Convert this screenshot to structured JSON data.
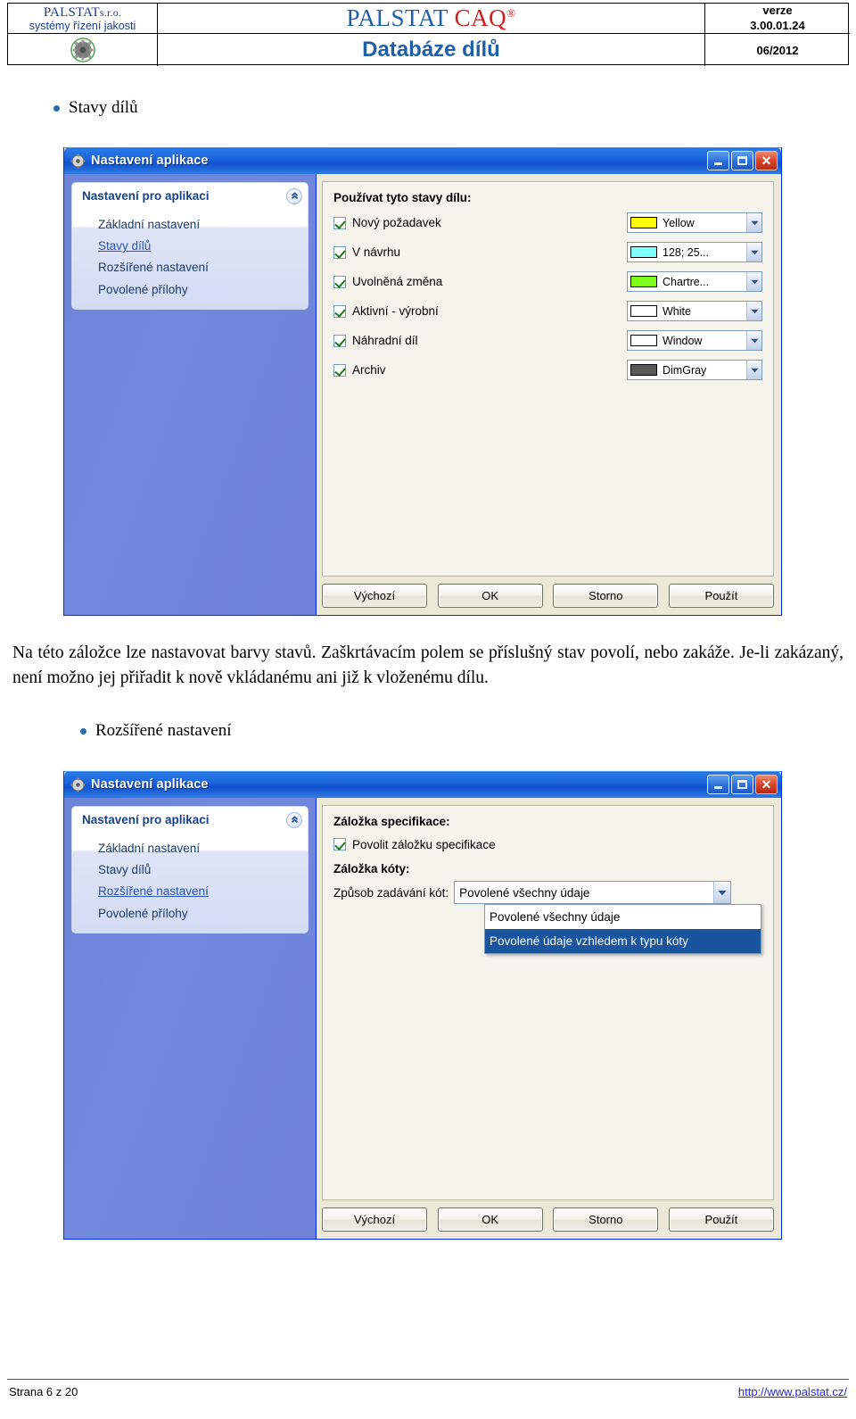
{
  "header": {
    "company_line1": "PALSTAT",
    "company_line1_small": "s.r.o.",
    "company_line2": "systémy řízení jakosti",
    "product_main": "PALSTAT",
    "product_accent": "CAQ",
    "product_registered": "®",
    "document_title": "Databáze dílů",
    "version_label": "verze",
    "version_value": "3.00.01.24",
    "date_value": "06/2012",
    "logo_icon": "gear-icon"
  },
  "sections": {
    "bullet1": "Stavy dílů",
    "bullet2": "Rozšířené nastavení",
    "paragraph": "Na této záložce lze nastavovat barvy stavů. Zaškrtávacím polem se příslušný stav povolí, nebo zakáže. Je-li zakázaný, není možno jej přiřadit k nově vkládanému ani již k vloženému dílu."
  },
  "dialog1": {
    "title": "Nastavení aplikace",
    "title_icon": "gear-icon",
    "window_buttons": {
      "minimize": "minimize-icon",
      "maximize": "maximize-icon",
      "close": "close-icon"
    },
    "nav": {
      "group_title": "Nastavení pro aplikaci",
      "collapse_icon": "chevron-up-icon",
      "items": [
        {
          "label": "Základní nastavení",
          "active": false
        },
        {
          "label": "Stavy dílů",
          "active": true
        },
        {
          "label": "Rozšířené nastavení",
          "active": false
        },
        {
          "label": "Povolené přílohy",
          "active": false
        }
      ]
    },
    "content": {
      "section_label": "Používat tyto stavy dílu:",
      "states": [
        {
          "label": "Nový požadavek",
          "checked": true,
          "color_name": "Yellow",
          "color_hex": "#FFFF00"
        },
        {
          "label": "V návrhu",
          "checked": true,
          "color_name": "128; 25...",
          "color_hex": "#80FFFF"
        },
        {
          "label": "Uvolněná změna",
          "checked": true,
          "color_name": "Chartre...",
          "color_hex": "#7CFC1A"
        },
        {
          "label": "Aktivní - výrobní",
          "checked": true,
          "color_name": "White",
          "color_hex": "#FFFFFF"
        },
        {
          "label": "Náhradní díl",
          "checked": true,
          "color_name": "Window",
          "color_hex": "#FFFFFF"
        },
        {
          "label": "Archiv",
          "checked": true,
          "color_name": "DimGray",
          "color_hex": "#585858"
        }
      ]
    },
    "buttons": {
      "default": "Výchozí",
      "ok": "OK",
      "cancel": "Storno",
      "apply": "Použít"
    }
  },
  "dialog2": {
    "title": "Nastavení aplikace",
    "title_icon": "gear-icon",
    "window_buttons": {
      "minimize": "minimize-icon",
      "maximize": "maximize-icon",
      "close": "close-icon"
    },
    "nav": {
      "group_title": "Nastavení pro aplikaci",
      "collapse_icon": "chevron-up-icon",
      "items": [
        {
          "label": "Základní nastavení",
          "active": false
        },
        {
          "label": "Stavy dílů",
          "active": false
        },
        {
          "label": "Rozšířené nastavení",
          "active": true
        },
        {
          "label": "Povolené přílohy",
          "active": false
        }
      ]
    },
    "content": {
      "spec_section_label": "Záložka specifikace:",
      "spec_checkbox_label": "Povolit záložku specifikace",
      "spec_checked": true,
      "kota_section_label": "Záložka kóty:",
      "kota_field_label": "Způsob zadávání kót:",
      "kota_selected_value": "Povolené všechny údaje",
      "kota_options": [
        {
          "label": "Povolené všechny údaje",
          "selected": false
        },
        {
          "label": "Povolené údaje vzhledem k typu kóty",
          "selected": true
        }
      ]
    },
    "buttons": {
      "default": "Výchozí",
      "ok": "OK",
      "cancel": "Storno",
      "apply": "Použít"
    }
  },
  "footer": {
    "page": "Strana 6 z 20",
    "url": "http://www.palstat.cz/"
  }
}
